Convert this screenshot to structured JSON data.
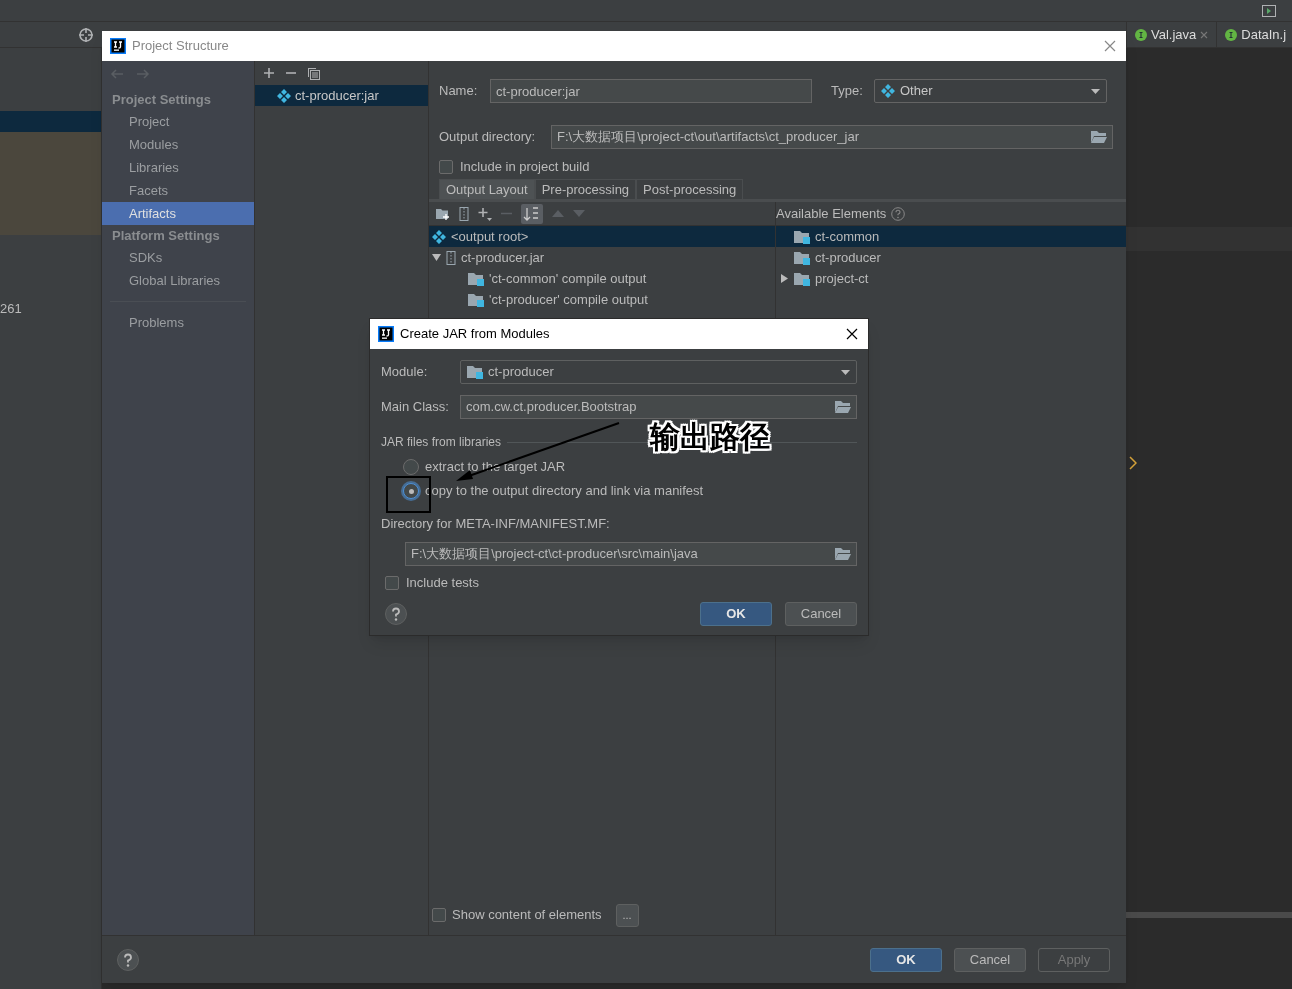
{
  "background_ide": {
    "line_number": "261",
    "tabs": [
      {
        "label": "Val.java",
        "closable": true
      },
      {
        "label": "DataIn.j",
        "closable": false
      }
    ]
  },
  "project_structure": {
    "title": "Project Structure",
    "sidebar": [
      {
        "heading": "Project Settings",
        "items": [
          {
            "label": "Project",
            "selected": false
          },
          {
            "label": "Modules",
            "selected": false
          },
          {
            "label": "Libraries",
            "selected": false
          },
          {
            "label": "Facets",
            "selected": false
          },
          {
            "label": "Artifacts",
            "selected": true
          }
        ]
      },
      {
        "heading": "Platform Settings",
        "items": [
          {
            "label": "SDKs",
            "selected": false
          },
          {
            "label": "Global Libraries",
            "selected": false
          }
        ]
      }
    ],
    "problems": {
      "label": "Problems"
    },
    "artifacts": [
      {
        "label": "ct-producer:jar",
        "selected": true
      }
    ],
    "name": {
      "label": "Name:",
      "value": "ct-producer:jar"
    },
    "type": {
      "label": "Type:",
      "value": "Other"
    },
    "output_directory": {
      "label": "Output directory:",
      "value": "F:\\大数据项目\\project-ct\\out\\artifacts\\ct_producer_jar"
    },
    "include_in_build": {
      "label": "Include in project build",
      "checked": false
    },
    "tabs": [
      {
        "label": "Output Layout",
        "selected": true
      },
      {
        "label": "Pre-processing",
        "selected": false
      },
      {
        "label": "Post-processing",
        "selected": false
      }
    ],
    "available_elements": {
      "label": "Available Elements"
    },
    "layout_tree": [
      {
        "label": "<output root>",
        "kind": "root",
        "selected": true
      },
      {
        "label": "ct-producer.jar",
        "kind": "jar",
        "selected": false,
        "expanded": true,
        "children": [
          {
            "label": "'ct-common' compile output",
            "kind": "module",
            "selected": false
          },
          {
            "label": "'ct-producer' compile output",
            "kind": "module",
            "selected": false
          }
        ]
      }
    ],
    "available_tree": [
      {
        "label": "ct-common",
        "selected": true
      },
      {
        "label": "ct-producer",
        "selected": false
      },
      {
        "label": "project-ct",
        "selected": false,
        "expanded": false
      }
    ],
    "show_content": {
      "label": "Show content of elements",
      "checked": false
    },
    "more_button": {
      "label": "..."
    },
    "buttons": [
      {
        "label": "OK",
        "kind": "primary"
      },
      {
        "label": "Cancel",
        "kind": "normal"
      },
      {
        "label": "Apply",
        "kind": "disabled"
      }
    ]
  },
  "create_jar": {
    "title": "Create JAR from Modules",
    "module": {
      "label": "Module:",
      "value": "ct-producer"
    },
    "main_class": {
      "label": "Main Class:",
      "value": "com.cw.ct.producer.Bootstrap"
    },
    "libraries_heading": "JAR files from libraries",
    "options": [
      {
        "label": "extract to the target JAR",
        "selected": false
      },
      {
        "label": "copy to the output directory and link via manifest",
        "selected": true
      }
    ],
    "manifest_dir": {
      "label": "Directory for META-INF/MANIFEST.MF:",
      "value": "F:\\大数据项目\\project-ct\\ct-producer\\src\\main\\java"
    },
    "include_tests": {
      "label": "Include tests",
      "checked": false
    },
    "buttons": [
      {
        "label": "OK",
        "kind": "primary"
      },
      {
        "label": "Cancel",
        "kind": "normal"
      }
    ]
  },
  "annotation": {
    "text": "输出路径"
  }
}
